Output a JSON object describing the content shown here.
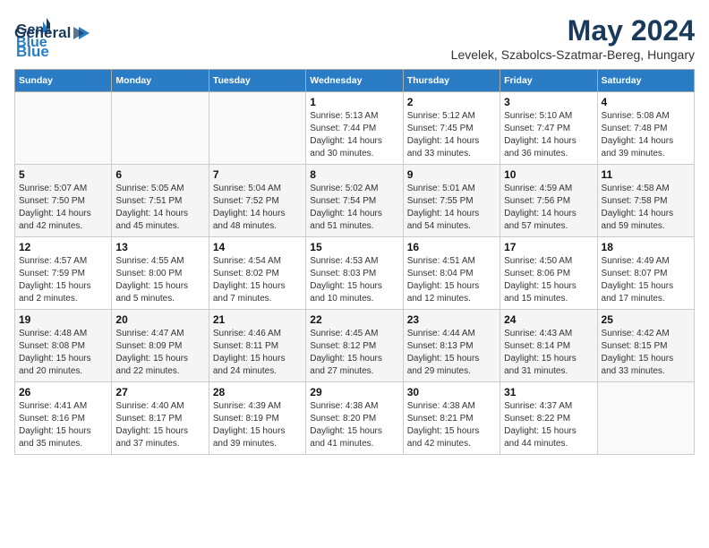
{
  "logo": {
    "general": "General",
    "blue": "Blue"
  },
  "title": {
    "month_year": "May 2024",
    "location": "Levelek, Szabolcs-Szatmar-Bereg, Hungary"
  },
  "days_of_week": [
    "Sunday",
    "Monday",
    "Tuesday",
    "Wednesday",
    "Thursday",
    "Friday",
    "Saturday"
  ],
  "weeks": [
    [
      {
        "date": "",
        "sunrise": "",
        "sunset": "",
        "daylight": ""
      },
      {
        "date": "",
        "sunrise": "",
        "sunset": "",
        "daylight": ""
      },
      {
        "date": "",
        "sunrise": "",
        "sunset": "",
        "daylight": ""
      },
      {
        "date": "1",
        "sunrise": "Sunrise: 5:13 AM",
        "sunset": "Sunset: 7:44 PM",
        "daylight": "Daylight: 14 hours and 30 minutes."
      },
      {
        "date": "2",
        "sunrise": "Sunrise: 5:12 AM",
        "sunset": "Sunset: 7:45 PM",
        "daylight": "Daylight: 14 hours and 33 minutes."
      },
      {
        "date": "3",
        "sunrise": "Sunrise: 5:10 AM",
        "sunset": "Sunset: 7:47 PM",
        "daylight": "Daylight: 14 hours and 36 minutes."
      },
      {
        "date": "4",
        "sunrise": "Sunrise: 5:08 AM",
        "sunset": "Sunset: 7:48 PM",
        "daylight": "Daylight: 14 hours and 39 minutes."
      }
    ],
    [
      {
        "date": "5",
        "sunrise": "Sunrise: 5:07 AM",
        "sunset": "Sunset: 7:50 PM",
        "daylight": "Daylight: 14 hours and 42 minutes."
      },
      {
        "date": "6",
        "sunrise": "Sunrise: 5:05 AM",
        "sunset": "Sunset: 7:51 PM",
        "daylight": "Daylight: 14 hours and 45 minutes."
      },
      {
        "date": "7",
        "sunrise": "Sunrise: 5:04 AM",
        "sunset": "Sunset: 7:52 PM",
        "daylight": "Daylight: 14 hours and 48 minutes."
      },
      {
        "date": "8",
        "sunrise": "Sunrise: 5:02 AM",
        "sunset": "Sunset: 7:54 PM",
        "daylight": "Daylight: 14 hours and 51 minutes."
      },
      {
        "date": "9",
        "sunrise": "Sunrise: 5:01 AM",
        "sunset": "Sunset: 7:55 PM",
        "daylight": "Daylight: 14 hours and 54 minutes."
      },
      {
        "date": "10",
        "sunrise": "Sunrise: 4:59 AM",
        "sunset": "Sunset: 7:56 PM",
        "daylight": "Daylight: 14 hours and 57 minutes."
      },
      {
        "date": "11",
        "sunrise": "Sunrise: 4:58 AM",
        "sunset": "Sunset: 7:58 PM",
        "daylight": "Daylight: 14 hours and 59 minutes."
      }
    ],
    [
      {
        "date": "12",
        "sunrise": "Sunrise: 4:57 AM",
        "sunset": "Sunset: 7:59 PM",
        "daylight": "Daylight: 15 hours and 2 minutes."
      },
      {
        "date": "13",
        "sunrise": "Sunrise: 4:55 AM",
        "sunset": "Sunset: 8:00 PM",
        "daylight": "Daylight: 15 hours and 5 minutes."
      },
      {
        "date": "14",
        "sunrise": "Sunrise: 4:54 AM",
        "sunset": "Sunset: 8:02 PM",
        "daylight": "Daylight: 15 hours and 7 minutes."
      },
      {
        "date": "15",
        "sunrise": "Sunrise: 4:53 AM",
        "sunset": "Sunset: 8:03 PM",
        "daylight": "Daylight: 15 hours and 10 minutes."
      },
      {
        "date": "16",
        "sunrise": "Sunrise: 4:51 AM",
        "sunset": "Sunset: 8:04 PM",
        "daylight": "Daylight: 15 hours and 12 minutes."
      },
      {
        "date": "17",
        "sunrise": "Sunrise: 4:50 AM",
        "sunset": "Sunset: 8:06 PM",
        "daylight": "Daylight: 15 hours and 15 minutes."
      },
      {
        "date": "18",
        "sunrise": "Sunrise: 4:49 AM",
        "sunset": "Sunset: 8:07 PM",
        "daylight": "Daylight: 15 hours and 17 minutes."
      }
    ],
    [
      {
        "date": "19",
        "sunrise": "Sunrise: 4:48 AM",
        "sunset": "Sunset: 8:08 PM",
        "daylight": "Daylight: 15 hours and 20 minutes."
      },
      {
        "date": "20",
        "sunrise": "Sunrise: 4:47 AM",
        "sunset": "Sunset: 8:09 PM",
        "daylight": "Daylight: 15 hours and 22 minutes."
      },
      {
        "date": "21",
        "sunrise": "Sunrise: 4:46 AM",
        "sunset": "Sunset: 8:11 PM",
        "daylight": "Daylight: 15 hours and 24 minutes."
      },
      {
        "date": "22",
        "sunrise": "Sunrise: 4:45 AM",
        "sunset": "Sunset: 8:12 PM",
        "daylight": "Daylight: 15 hours and 27 minutes."
      },
      {
        "date": "23",
        "sunrise": "Sunrise: 4:44 AM",
        "sunset": "Sunset: 8:13 PM",
        "daylight": "Daylight: 15 hours and 29 minutes."
      },
      {
        "date": "24",
        "sunrise": "Sunrise: 4:43 AM",
        "sunset": "Sunset: 8:14 PM",
        "daylight": "Daylight: 15 hours and 31 minutes."
      },
      {
        "date": "25",
        "sunrise": "Sunrise: 4:42 AM",
        "sunset": "Sunset: 8:15 PM",
        "daylight": "Daylight: 15 hours and 33 minutes."
      }
    ],
    [
      {
        "date": "26",
        "sunrise": "Sunrise: 4:41 AM",
        "sunset": "Sunset: 8:16 PM",
        "daylight": "Daylight: 15 hours and 35 minutes."
      },
      {
        "date": "27",
        "sunrise": "Sunrise: 4:40 AM",
        "sunset": "Sunset: 8:17 PM",
        "daylight": "Daylight: 15 hours and 37 minutes."
      },
      {
        "date": "28",
        "sunrise": "Sunrise: 4:39 AM",
        "sunset": "Sunset: 8:19 PM",
        "daylight": "Daylight: 15 hours and 39 minutes."
      },
      {
        "date": "29",
        "sunrise": "Sunrise: 4:38 AM",
        "sunset": "Sunset: 8:20 PM",
        "daylight": "Daylight: 15 hours and 41 minutes."
      },
      {
        "date": "30",
        "sunrise": "Sunrise: 4:38 AM",
        "sunset": "Sunset: 8:21 PM",
        "daylight": "Daylight: 15 hours and 42 minutes."
      },
      {
        "date": "31",
        "sunrise": "Sunrise: 4:37 AM",
        "sunset": "Sunset: 8:22 PM",
        "daylight": "Daylight: 15 hours and 44 minutes."
      },
      {
        "date": "",
        "sunrise": "",
        "sunset": "",
        "daylight": ""
      }
    ]
  ]
}
